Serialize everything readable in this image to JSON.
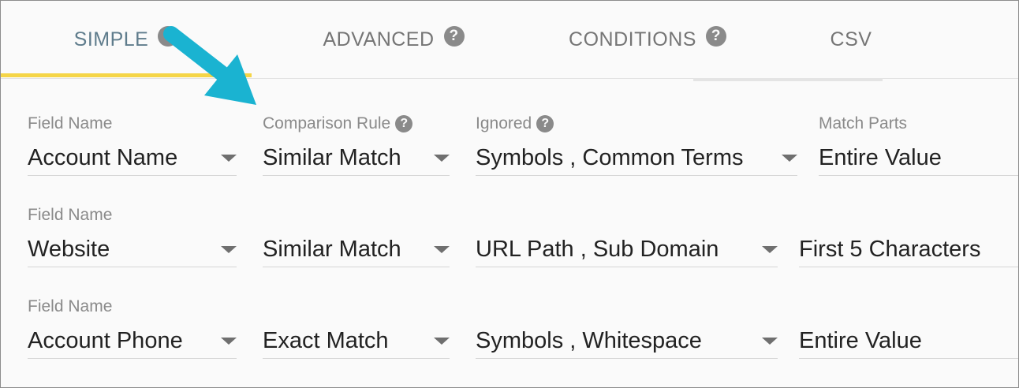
{
  "tabs": [
    {
      "label": "SIMPLE",
      "help": "?"
    },
    {
      "label": "ADVANCED",
      "help": "?"
    },
    {
      "label": "CONDITIONS",
      "help": "?"
    },
    {
      "label": "CSV"
    }
  ],
  "headers": {
    "field_name": "Field Name",
    "comparison_rule": "Comparison Rule",
    "ignored": "Ignored",
    "match_parts": "Match Parts",
    "help": "?"
  },
  "rows": [
    {
      "field_label": "Field Name",
      "field": "Account Name",
      "rule": "Similar Match",
      "ignored": "Symbols , Common Terms",
      "match_parts": "Entire Value"
    },
    {
      "field_label": "Field Name",
      "field": "Website",
      "rule": "Similar Match",
      "ignored": "URL Path , Sub Domain",
      "match_parts": "First 5 Characters"
    },
    {
      "field_label": "Field Name",
      "field": "Account Phone",
      "rule": "Exact Match",
      "ignored": "Symbols , Whitespace",
      "match_parts": "Entire Value"
    }
  ],
  "colors": {
    "active_tab_underline": "#f5d547",
    "annotation_arrow": "#1ab3d1"
  },
  "icons": {
    "help": "question-circle-icon",
    "dropdown": "caret-down-icon",
    "annotation": "annotation-arrow-icon"
  }
}
